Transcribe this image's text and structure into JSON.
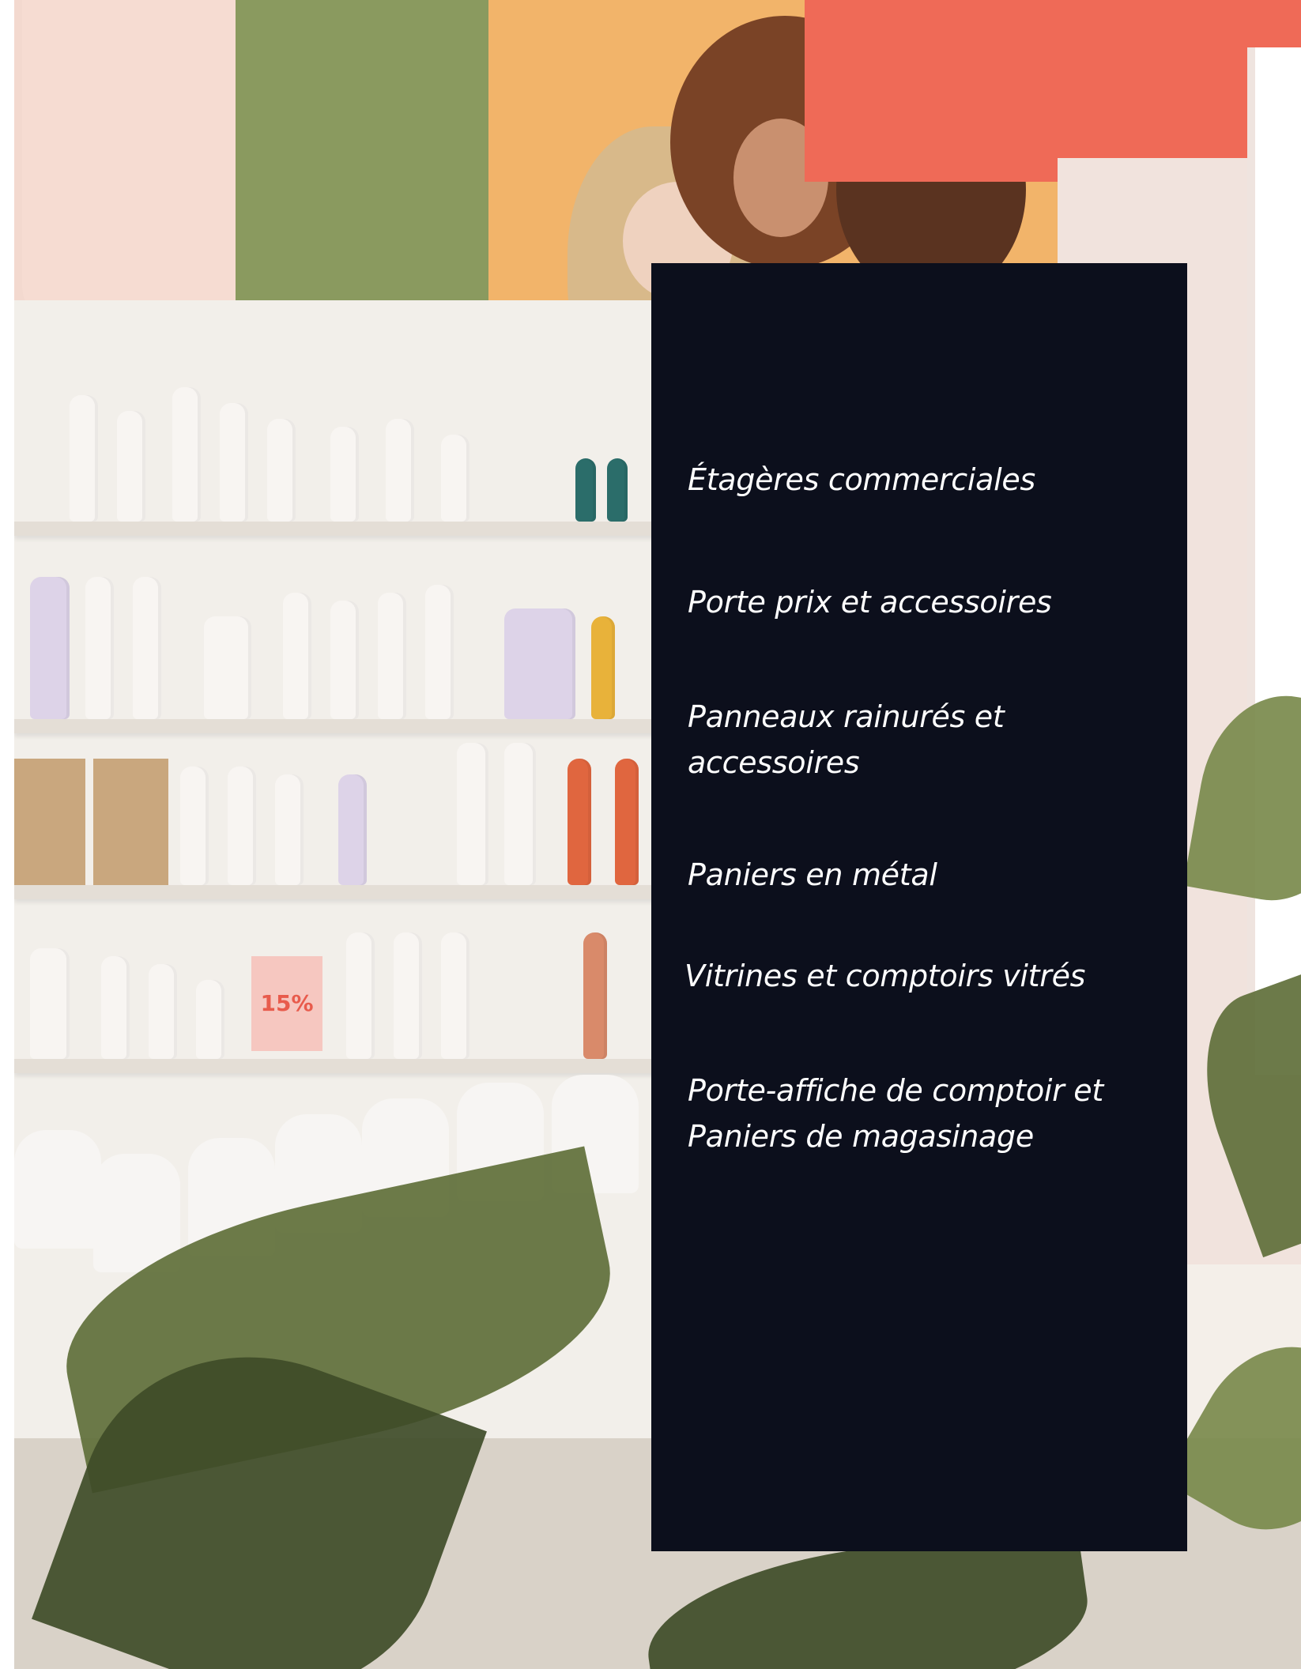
{
  "panel": {
    "items": [
      {
        "label": "Étagères commerciales"
      },
      {
        "label": "Porte prix et accessoires"
      },
      {
        "label": "Panneaux rainurés et accessoires"
      },
      {
        "label": "Paniers en métal"
      },
      {
        "label": "Vitrines et comptoirs vitrés"
      },
      {
        "label": "Porte-affiche de comptoir et Paniers de magasinage"
      }
    ],
    "background_color": "#0c0f1c",
    "text_color": "#ffffff"
  },
  "background_photo": {
    "subject": "retail store interior with shelves of hair care products, wall posters, and foreground plant leaves",
    "sign": {
      "label": "15%"
    }
  }
}
